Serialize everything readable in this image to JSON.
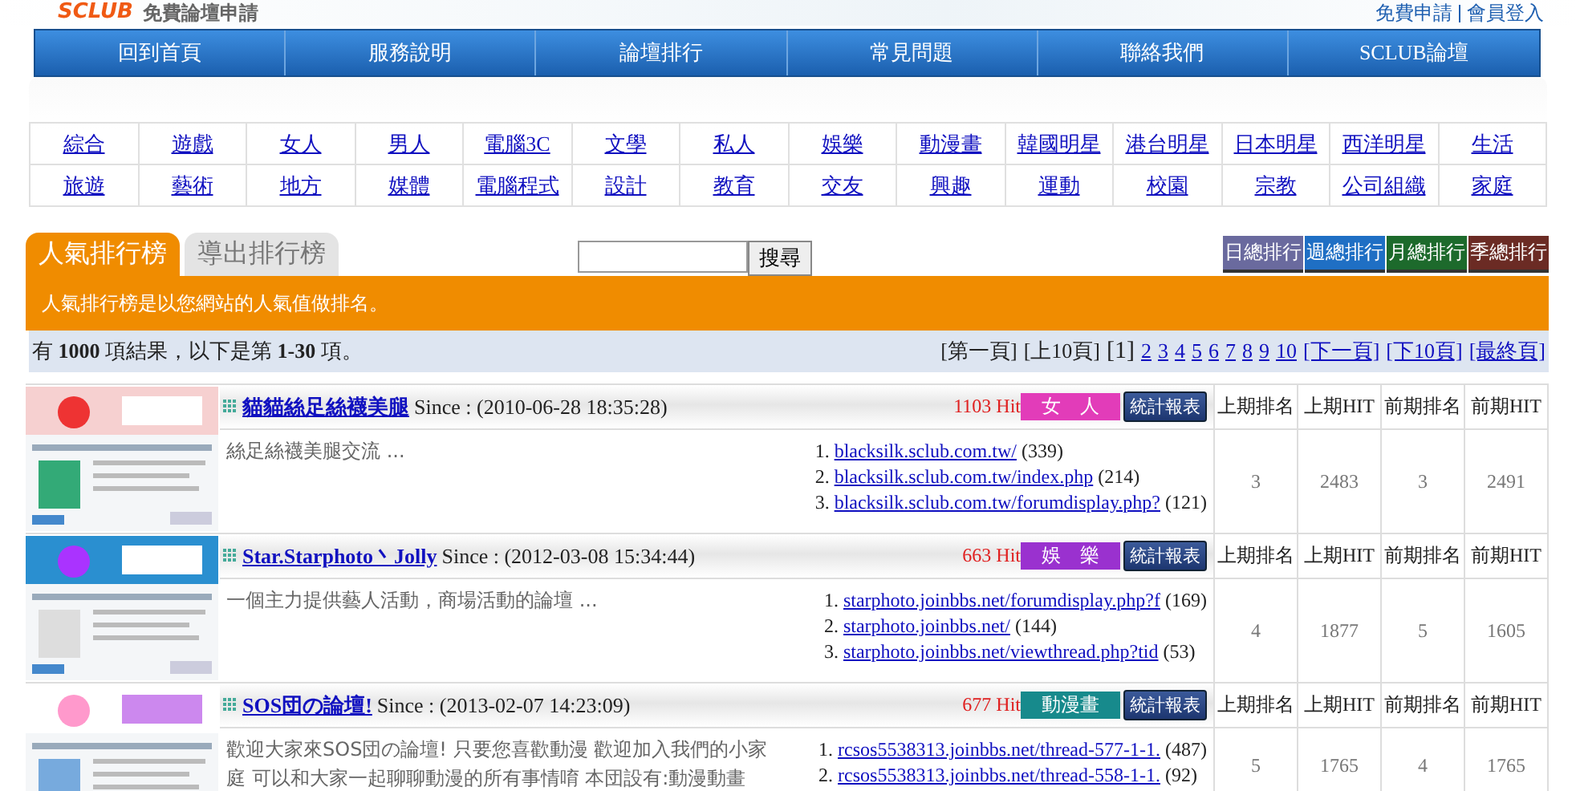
{
  "header": {
    "logo": "SCLUB",
    "subtitle": "免費論壇申請",
    "links": [
      "免費申請",
      "會員登入"
    ]
  },
  "nav": [
    "回到首頁",
    "服務說明",
    "論壇排行",
    "常見問題",
    "聯絡我們",
    "SCLUB論壇"
  ],
  "categories": [
    [
      "綜合",
      "遊戲",
      "女人",
      "男人",
      "電腦3C",
      "文學",
      "私人",
      "娛樂",
      "動漫畫",
      "韓國明星",
      "港台明星",
      "日本明星",
      "西洋明星",
      "生活"
    ],
    [
      "旅遊",
      "藝術",
      "地方",
      "媒體",
      "電腦程式",
      "設計",
      "教育",
      "交友",
      "興趣",
      "運動",
      "校園",
      "宗教",
      "公司組織",
      "家庭"
    ]
  ],
  "tabs": [
    {
      "label": "人氣排行榜",
      "selected": true
    },
    {
      "label": "導出排行榜",
      "selected": false
    }
  ],
  "search": {
    "button": "搜尋"
  },
  "period_buttons": [
    {
      "label": "日總排行",
      "color": "#6a6a9e"
    },
    {
      "label": "週總排行",
      "color": "#1f6fc4"
    },
    {
      "label": "月總排行",
      "color": "#1d6a2c"
    },
    {
      "label": "季總排行",
      "color": "#6b2b24"
    }
  ],
  "notice": "人氣排行榜是以您網站的人氣值做排名。",
  "summary": "有 **1000** 項結果，以下是第 **1-30** 項。",
  "pagination": [
    {
      "label": "[第一頁]",
      "kind": "plain"
    },
    {
      "label": "[上10頁]",
      "kind": "plain"
    },
    {
      "label": "[1]",
      "kind": "current"
    },
    {
      "label": "2",
      "kind": "link"
    },
    {
      "label": "3",
      "kind": "link"
    },
    {
      "label": "4",
      "kind": "link"
    },
    {
      "label": "5",
      "kind": "link"
    },
    {
      "label": "6",
      "kind": "link"
    },
    {
      "label": "7",
      "kind": "link"
    },
    {
      "label": "8",
      "kind": "link"
    },
    {
      "label": "9",
      "kind": "link"
    },
    {
      "label": "10",
      "kind": "link"
    },
    {
      "label": "[下一頁]",
      "kind": "link"
    },
    {
      "label": "[下10頁]",
      "kind": "link"
    },
    {
      "label": "[最終頁]",
      "kind": "link"
    }
  ],
  "forums": [
    {
      "thumbnail": {
        "kind": "picture"
      },
      "title": "貓貓絲足絲襪美腿",
      "since": "Since : (2010-06-28 18:35:28)",
      "hits": "1103 Hit",
      "category": {
        "label": "女　人",
        "color": "#e23cb9"
      },
      "report": "統計報表",
      "stat_headers": [
        "上期排名",
        "上期HIT",
        "前期排名",
        "前期HIT"
      ],
      "description": "絲足絲襪美腿交流 ...",
      "links": [
        {
          "number": "1.",
          "url": "blacksilk.sclub.com.tw/",
          "count": "(339)"
        },
        {
          "number": "2.",
          "url": "blacksilk.sclub.com.tw/index.php",
          "count": "(214)"
        },
        {
          "number": "3.",
          "url": "blacksilk.sclub.com.tw/forumdisplay.php?",
          "count": "(121)"
        }
      ],
      "stats": [
        "3",
        "2483",
        "3",
        "2491"
      ]
    },
    {
      "thumbnail": {
        "kind": "picture"
      },
      "title": "Star.Starphoto丶Jolly",
      "since": "Since : (2012-03-08 15:34:44)",
      "hits": "663 Hit",
      "category": {
        "label": "娛　樂",
        "color": "#9a31cf"
      },
      "report": "統計報表",
      "stat_headers": [
        "上期排名",
        "上期HIT",
        "前期排名",
        "前期HIT"
      ],
      "description": "一個主力提供藝人活動，商場活動的論壇 ...",
      "links": [
        {
          "number": "1.",
          "url": "starphoto.joinbbs.net/forumdisplay.php?f",
          "count": "(169)"
        },
        {
          "number": "2.",
          "url": "starphoto.joinbbs.net/",
          "count": "(144)"
        },
        {
          "number": "3.",
          "url": "starphoto.joinbbs.net/viewthread.php?tid",
          "count": "(53)"
        }
      ],
      "stats": [
        "4",
        "1877",
        "5",
        "1605"
      ]
    },
    {
      "thumbnail": {
        "kind": "picture"
      },
      "title": "SOS団の論壇!",
      "since": "Since : (2013-02-07 14:23:09)",
      "hits": "677 Hit",
      "category": {
        "label": "動漫畫",
        "color": "#178a8c"
      },
      "report": "統計報表",
      "stat_headers": [
        "上期排名",
        "上期HIT",
        "前期排名",
        "前期HIT"
      ],
      "description": "歡迎大家來SOS団の論壇! 只要您喜歡動漫 歡迎加入我們的小家庭 可以和大家一起聊聊動漫的所有事情唷 本団設有:動漫動畫",
      "links": [
        {
          "number": "1.",
          "url": "rcsos5538313.joinbbs.net/thread-577-1-1.",
          "count": "(487)"
        },
        {
          "number": "2.",
          "url": "rcsos5538313.joinbbs.net/thread-558-1-1.",
          "count": "(92)"
        }
      ],
      "stats": [
        "5",
        "1765",
        "4",
        "1765"
      ]
    }
  ]
}
